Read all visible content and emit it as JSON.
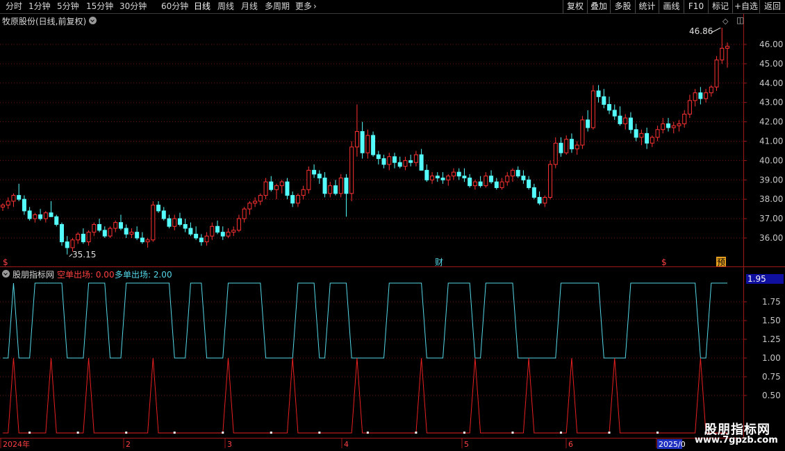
{
  "toolbar": {
    "periods": [
      "分时",
      "1分钟",
      "5分钟",
      "15分钟",
      "30分钟",
      "60分钟",
      "日线",
      "周线",
      "月线",
      "多周期",
      "更多"
    ],
    "active_period": "日线",
    "more_arrow": "›",
    "right_buttons": [
      "复权",
      "叠加",
      "多股",
      "统计",
      "画线",
      "F10",
      "标记",
      "+自选",
      "返回"
    ]
  },
  "main_panel": {
    "title": "牧原股份(日线,前复权)",
    "high_label": "46.86",
    "low_label": "35.15",
    "price_ticks": [
      "46.00",
      "45.00",
      "44.00",
      "43.00",
      "42.00",
      "41.00",
      "40.00",
      "39.00",
      "38.00",
      "37.00",
      "36.00"
    ],
    "markers": [
      "$",
      "财",
      "$",
      "预"
    ]
  },
  "indicator_panel": {
    "name": "股朋指标网",
    "short_label": "空单出场: 0.00",
    "long_label": "多单出场: 2.00",
    "current_value": "1.95",
    "ticks": [
      "1.75",
      "1.50",
      "1.25",
      "1.00",
      "0.75",
      "0.50"
    ]
  },
  "time_axis": {
    "labels": [
      "2024年",
      "2",
      "3",
      "4",
      "5",
      "6",
      "2025/0"
    ]
  },
  "watermark": {
    "title": "股朋指标网",
    "url": "www.7gpzb.com"
  },
  "colors": {
    "up": "#ff3232",
    "down": "#54fcfc",
    "grid": "#7a1010",
    "axis_text": "#c8c8c8",
    "indicator_cyan": "#54d8e8",
    "indicator_red": "#e82020"
  },
  "chart_data": {
    "type": "candlestick",
    "ylim": [
      35.0,
      47.0
    ],
    "candles": [
      [
        37.6,
        37.8,
        37.4,
        37.7
      ],
      [
        37.7,
        38.1,
        37.5,
        37.9
      ],
      [
        37.9,
        38.3,
        37.6,
        38.2
      ],
      [
        38.2,
        38.8,
        37.9,
        38.0
      ],
      [
        38.0,
        38.2,
        37.2,
        37.4
      ],
      [
        37.4,
        37.6,
        36.9,
        37.0
      ],
      [
        37.0,
        37.3,
        36.8,
        37.2
      ],
      [
        37.2,
        37.5,
        36.9,
        37.0
      ],
      [
        37.0,
        37.4,
        36.8,
        37.3
      ],
      [
        37.3,
        37.9,
        37.1,
        37.1
      ],
      [
        37.1,
        37.2,
        36.6,
        36.7
      ],
      [
        36.7,
        36.8,
        35.6,
        35.8
      ],
      [
        35.8,
        36.1,
        35.15,
        35.5
      ],
      [
        35.5,
        36.0,
        35.3,
        35.9
      ],
      [
        35.9,
        36.3,
        35.7,
        36.2
      ],
      [
        36.2,
        36.5,
        35.7,
        35.8
      ],
      [
        35.8,
        36.4,
        35.6,
        36.3
      ],
      [
        36.3,
        36.8,
        36.1,
        36.7
      ],
      [
        36.7,
        37.0,
        36.3,
        36.4
      ],
      [
        36.4,
        36.6,
        36.0,
        36.1
      ],
      [
        36.1,
        36.6,
        36.0,
        36.5
      ],
      [
        36.5,
        36.9,
        36.3,
        36.8
      ],
      [
        36.8,
        37.2,
        36.4,
        36.5
      ],
      [
        36.5,
        36.7,
        36.0,
        36.2
      ],
      [
        36.2,
        36.5,
        36.0,
        36.3
      ],
      [
        36.3,
        36.6,
        35.9,
        36.0
      ],
      [
        36.0,
        36.3,
        35.7,
        35.8
      ],
      [
        35.8,
        36.0,
        35.5,
        35.9
      ],
      [
        35.9,
        37.9,
        35.8,
        37.7
      ],
      [
        37.7,
        37.9,
        37.3,
        37.4
      ],
      [
        37.4,
        37.6,
        36.9,
        37.0
      ],
      [
        37.0,
        37.2,
        36.5,
        36.6
      ],
      [
        36.6,
        37.2,
        36.4,
        37.0
      ],
      [
        37.0,
        37.3,
        36.6,
        36.7
      ],
      [
        36.7,
        37.0,
        36.3,
        36.5
      ],
      [
        36.5,
        36.8,
        36.1,
        36.2
      ],
      [
        36.2,
        36.6,
        35.9,
        36.0
      ],
      [
        36.0,
        36.2,
        35.6,
        35.8
      ],
      [
        35.8,
        36.3,
        35.6,
        36.1
      ],
      [
        36.1,
        36.8,
        35.9,
        36.6
      ],
      [
        36.6,
        36.9,
        36.2,
        36.3
      ],
      [
        36.3,
        36.6,
        35.9,
        36.1
      ],
      [
        36.1,
        36.5,
        36.0,
        36.3
      ],
      [
        36.3,
        36.6,
        36.1,
        36.4
      ],
      [
        36.4,
        37.2,
        36.3,
        37.0
      ],
      [
        37.0,
        37.6,
        36.8,
        37.5
      ],
      [
        37.5,
        37.9,
        37.2,
        37.8
      ],
      [
        37.8,
        38.1,
        37.6,
        37.9
      ],
      [
        37.9,
        38.3,
        37.7,
        38.2
      ],
      [
        38.2,
        39.1,
        38.0,
        38.9
      ],
      [
        38.9,
        39.2,
        38.4,
        38.5
      ],
      [
        38.5,
        38.8,
        38.0,
        38.7
      ],
      [
        38.7,
        39.0,
        38.3,
        38.9
      ],
      [
        38.9,
        39.1,
        38.0,
        38.2
      ],
      [
        38.2,
        38.4,
        37.6,
        37.8
      ],
      [
        37.8,
        38.3,
        37.6,
        38.2
      ],
      [
        38.2,
        38.7,
        38.0,
        38.5
      ],
      [
        38.5,
        39.7,
        38.3,
        39.5
      ],
      [
        39.5,
        39.8,
        39.1,
        39.3
      ],
      [
        39.3,
        39.5,
        38.8,
        39.1
      ],
      [
        39.1,
        39.4,
        38.1,
        38.3
      ],
      [
        38.3,
        38.9,
        38.1,
        38.7
      ],
      [
        38.7,
        39.0,
        38.2,
        38.3
      ],
      [
        38.3,
        39.3,
        38.1,
        39.1
      ],
      [
        39.1,
        39.3,
        37.1,
        38.3
      ],
      [
        38.3,
        41.0,
        37.9,
        40.7
      ],
      [
        40.7,
        42.9,
        40.2,
        41.5
      ],
      [
        41.5,
        42.0,
        40.1,
        40.4
      ],
      [
        40.4,
        41.6,
        40.1,
        41.3
      ],
      [
        41.3,
        41.5,
        40.2,
        40.3
      ],
      [
        40.3,
        40.5,
        39.8,
        40.1
      ],
      [
        40.1,
        40.3,
        39.6,
        39.8
      ],
      [
        39.8,
        40.4,
        39.5,
        40.2
      ],
      [
        40.2,
        40.4,
        39.6,
        39.9
      ],
      [
        39.9,
        40.2,
        39.6,
        39.7
      ],
      [
        39.7,
        40.2,
        39.5,
        40.0
      ],
      [
        40.0,
        40.3,
        39.7,
        39.9
      ],
      [
        39.9,
        40.5,
        39.7,
        40.3
      ],
      [
        40.3,
        40.6,
        39.6,
        39.5
      ],
      [
        39.5,
        39.8,
        38.9,
        39.0
      ],
      [
        39.0,
        39.4,
        38.8,
        39.2
      ],
      [
        39.2,
        39.4,
        38.9,
        39.1
      ],
      [
        39.1,
        39.4,
        38.8,
        39.0
      ],
      [
        39.0,
        39.3,
        38.7,
        39.2
      ],
      [
        39.2,
        39.6,
        39.0,
        39.4
      ],
      [
        39.4,
        39.6,
        39.0,
        39.2
      ],
      [
        39.2,
        39.6,
        38.9,
        39.1
      ],
      [
        39.1,
        39.3,
        38.6,
        38.7
      ],
      [
        38.7,
        39.0,
        38.5,
        38.9
      ],
      [
        38.9,
        39.2,
        38.6,
        38.7
      ],
      [
        38.7,
        39.4,
        38.6,
        39.2
      ],
      [
        39.2,
        39.5,
        38.8,
        38.9
      ],
      [
        38.9,
        39.1,
        38.5,
        38.6
      ],
      [
        38.6,
        39.1,
        38.5,
        38.9
      ],
      [
        38.9,
        39.4,
        38.7,
        39.2
      ],
      [
        39.2,
        39.6,
        38.9,
        39.5
      ],
      [
        39.5,
        39.7,
        39.1,
        39.2
      ],
      [
        39.2,
        39.5,
        38.8,
        39.0
      ],
      [
        39.0,
        39.2,
        38.5,
        38.6
      ],
      [
        38.6,
        38.8,
        38.0,
        38.1
      ],
      [
        38.1,
        38.4,
        37.7,
        37.8
      ],
      [
        37.8,
        38.2,
        37.6,
        38.1
      ],
      [
        38.1,
        40.0,
        38.0,
        39.8
      ],
      [
        39.8,
        41.2,
        39.6,
        40.9
      ],
      [
        40.9,
        41.2,
        40.2,
        40.4
      ],
      [
        40.4,
        41.3,
        40.3,
        41.1
      ],
      [
        41.1,
        41.4,
        40.4,
        40.6
      ],
      [
        40.6,
        41.0,
        40.3,
        40.8
      ],
      [
        40.8,
        42.3,
        40.6,
        42.1
      ],
      [
        42.1,
        42.6,
        41.5,
        41.7
      ],
      [
        41.7,
        43.9,
        41.6,
        43.6
      ],
      [
        43.6,
        43.9,
        43.0,
        43.3
      ],
      [
        43.3,
        43.7,
        42.7,
        42.9
      ],
      [
        42.9,
        43.3,
        42.4,
        42.6
      ],
      [
        42.6,
        42.9,
        42.1,
        42.3
      ],
      [
        42.3,
        42.8,
        41.8,
        41.9
      ],
      [
        41.9,
        42.4,
        41.6,
        42.2
      ],
      [
        42.2,
        42.5,
        41.4,
        41.6
      ],
      [
        41.6,
        41.9,
        41.0,
        41.2
      ],
      [
        41.2,
        41.6,
        40.8,
        41.4
      ],
      [
        41.4,
        41.7,
        40.6,
        40.9
      ],
      [
        40.9,
        41.3,
        40.7,
        41.2
      ],
      [
        41.2,
        41.8,
        41.0,
        41.6
      ],
      [
        41.6,
        42.2,
        41.4,
        41.9
      ],
      [
        41.9,
        42.2,
        41.5,
        41.7
      ],
      [
        41.7,
        42.0,
        41.4,
        41.8
      ],
      [
        41.8,
        42.1,
        41.5,
        41.9
      ],
      [
        41.9,
        42.6,
        41.7,
        42.4
      ],
      [
        42.4,
        43.4,
        42.2,
        43.1
      ],
      [
        43.1,
        43.7,
        42.8,
        43.5
      ],
      [
        43.5,
        43.8,
        42.9,
        43.2
      ],
      [
        43.2,
        43.7,
        43.0,
        43.5
      ],
      [
        43.5,
        43.9,
        43.3,
        43.8
      ],
      [
        43.8,
        45.4,
        43.6,
        45.2
      ],
      [
        45.2,
        46.86,
        45.0,
        45.8
      ],
      [
        45.8,
        46.1,
        44.8,
        45.9
      ]
    ],
    "indicator": {
      "long_exit_periods": [
        [
          0,
          1
        ],
        [
          3,
          5
        ],
        [
          12,
          15
        ],
        [
          20,
          22
        ],
        [
          32,
          34
        ],
        [
          38,
          41
        ],
        [
          49,
          54
        ],
        [
          59,
          60
        ],
        [
          65,
          71
        ],
        [
          79,
          82
        ],
        [
          88,
          89
        ],
        [
          96,
          103
        ],
        [
          112,
          116
        ],
        [
          130,
          131
        ]
      ],
      "short_exit_days": [
        2,
        9,
        16,
        28,
        42,
        54,
        66,
        78,
        88,
        98,
        106,
        114,
        130
      ]
    }
  }
}
